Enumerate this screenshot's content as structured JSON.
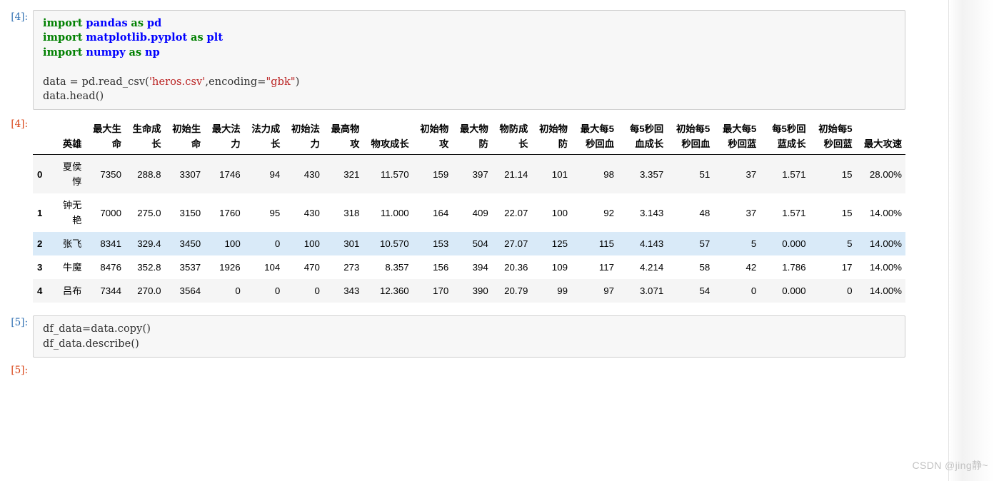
{
  "notebook": {
    "cells": [
      {
        "type": "input",
        "prompt": "[4]:",
        "source_lines": [
          "import pandas as pd",
          "import matplotlib.pyplot as plt",
          "import numpy as np",
          "",
          "data = pd.read_csv('heros.csv',encoding=\"gbk\")",
          "data.head()"
        ]
      },
      {
        "type": "output",
        "prompt": "[4]:"
      },
      {
        "type": "input",
        "prompt": "[5]:",
        "source_lines": [
          "df_data=data.copy()",
          "df_data.describe()"
        ]
      },
      {
        "type": "output",
        "prompt": "[5]:"
      }
    ]
  },
  "dataframe": {
    "index_header": "",
    "columns": [
      "英雄",
      "最大生命",
      "生命成长",
      "初始生命",
      "最大法力",
      "法力成长",
      "初始法力",
      "最高物攻",
      "物攻成长",
      "初始物攻",
      "最大物防",
      "物防成长",
      "初始物防",
      "最大每5秒回血",
      "每5秒回血成长",
      "初始每5秒回血",
      "最大每5秒回蓝",
      "每5秒回蓝成长",
      "初始每5秒回蓝",
      "最大攻速"
    ],
    "index": [
      "0",
      "1",
      "2",
      "3",
      "4"
    ],
    "rows": [
      [
        "夏侯惇",
        "7350",
        "288.8",
        "3307",
        "1746",
        "94",
        "430",
        "321",
        "11.570",
        "159",
        "397",
        "21.14",
        "101",
        "98",
        "3.357",
        "51",
        "37",
        "1.571",
        "15",
        "28.00%"
      ],
      [
        "钟无艳",
        "7000",
        "275.0",
        "3150",
        "1760",
        "95",
        "430",
        "318",
        "11.000",
        "164",
        "409",
        "22.07",
        "100",
        "92",
        "3.143",
        "48",
        "37",
        "1.571",
        "15",
        "14.00%"
      ],
      [
        "张飞",
        "8341",
        "329.4",
        "3450",
        "100",
        "0",
        "100",
        "301",
        "10.570",
        "153",
        "504",
        "27.07",
        "125",
        "115",
        "4.143",
        "57",
        "5",
        "0.000",
        "5",
        "14.00%"
      ],
      [
        "牛魔",
        "8476",
        "352.8",
        "3537",
        "1926",
        "104",
        "470",
        "273",
        "8.357",
        "156",
        "394",
        "20.36",
        "109",
        "117",
        "4.214",
        "58",
        "42",
        "1.786",
        "17",
        "14.00%"
      ],
      [
        "吕布",
        "7344",
        "270.0",
        "3564",
        "0",
        "0",
        "0",
        "343",
        "12.360",
        "170",
        "390",
        "20.79",
        "99",
        "97",
        "3.071",
        "54",
        "0",
        "0.000",
        "0",
        "14.00%"
      ]
    ],
    "selected_row_index": 2
  },
  "watermark": {
    "text": "CSDN @jing静~"
  },
  "colors": {
    "keyword": "#008000",
    "module": "#0000ff",
    "string": "#ba2121",
    "prompt_in": "#3070b3",
    "prompt_out": "#d84315",
    "selected_row": "#d9eaf8",
    "odd_row": "#f5f5f5",
    "cell_bg": "#f7f7f7"
  }
}
